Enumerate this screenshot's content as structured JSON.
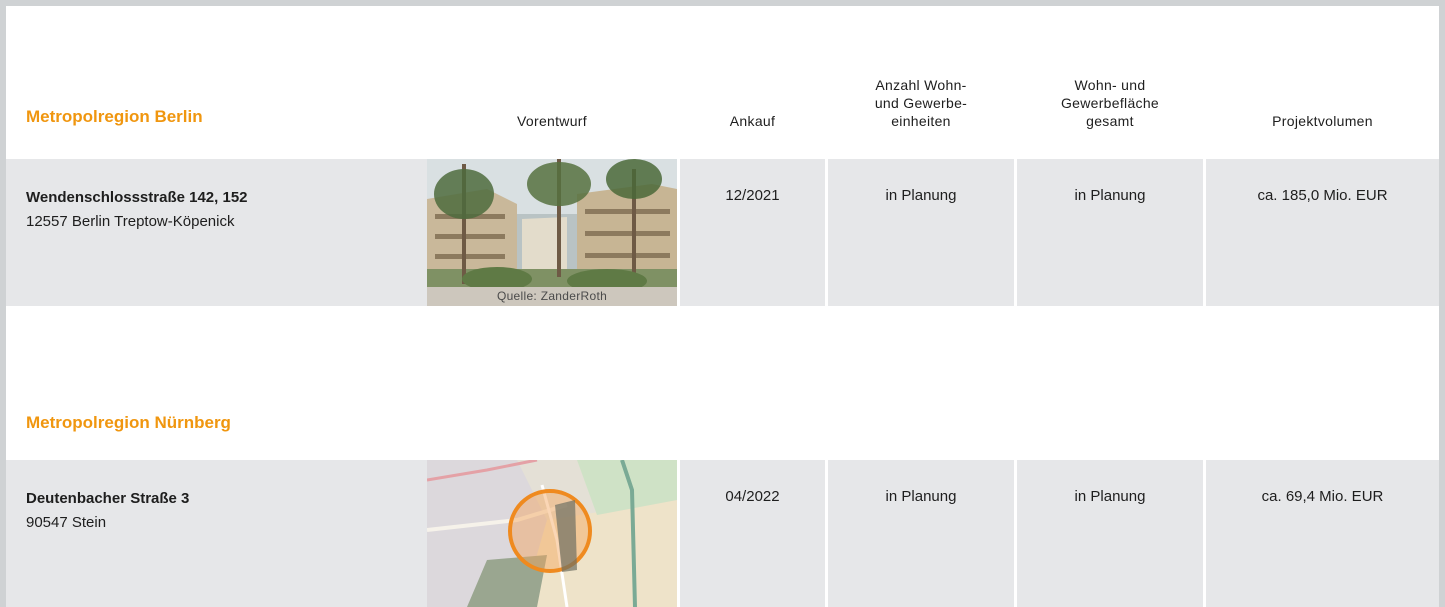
{
  "headers": {
    "vorentwurf": "Vorentwurf",
    "ankauf": "Ankauf",
    "anzahl": [
      "Anzahl Wohn-",
      "und Gewerbe-",
      "einheiten"
    ],
    "flaeche": [
      "Wohn- und",
      "Gewerbefläche",
      "gesamt"
    ],
    "volumen": "Projektvolumen"
  },
  "regions": [
    {
      "title": "Metropolregion Berlin",
      "project": {
        "street": "Wendenschlossstraße 142, 152",
        "city": "12557 Berlin Treptow-Köpenick",
        "image_caption": "Quelle: ZanderRoth",
        "ankauf": "12/2021",
        "einheiten": "in Planung",
        "flaeche": "in Planung",
        "volumen": "ca. 185,0 Mio. EUR"
      }
    },
    {
      "title": "Metropolregion Nürnberg",
      "project": {
        "street": "Deutenbacher Straße 3",
        "city": "90547 Stein",
        "ankauf": "04/2022",
        "einheiten": "in Planung",
        "flaeche": "in Planung",
        "volumen": "ca. 69,4 Mio. EUR"
      }
    }
  ],
  "colors": {
    "accent": "#f0960f",
    "row_bg": "#e6e7e9",
    "frame": "#cfd2d4"
  }
}
